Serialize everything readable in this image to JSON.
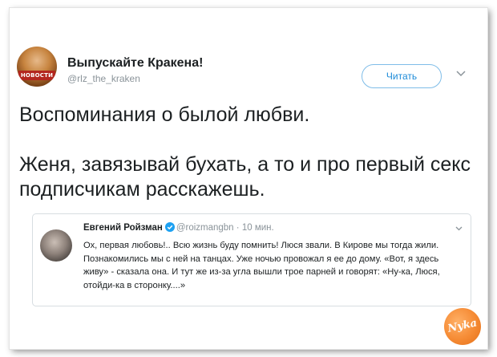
{
  "tweet": {
    "display_name": "Выпускайте Кракена!",
    "handle": "@rlz_the_kraken",
    "avatar_badge": "НОВОСТИ",
    "follow_label": "Читать",
    "text_line_1": "Воспоминания о былой любви.",
    "text_line_2": "Женя, завязывай бухать, а то и про первый секс подписчикам расскажешь."
  },
  "quoted": {
    "name": "Евгений Ройзман",
    "handle": "@roizmangbn",
    "separator": "·",
    "time": "10 мин.",
    "body": "Ох, первая любовь!.. Всю жизнь буду помнить! Люся звали. В Кирове мы тогда жили. Познакомились мы с ней на танцах. Уже ночью провожал я ее до дому. «Вот, я здесь живу» - сказала она. И тут же из-за угла вышли трое парней и говорят: «Ну-ка, Люся, отойди-ка в сторонку....»"
  },
  "watermark": {
    "text": "Nyka"
  },
  "colors": {
    "accent": "#1d8bd8",
    "verified": "#1da1f2",
    "logo": "#f58a33"
  },
  "icons": {
    "caret": "chevron-down-icon",
    "verified": "verified-badge-icon"
  }
}
